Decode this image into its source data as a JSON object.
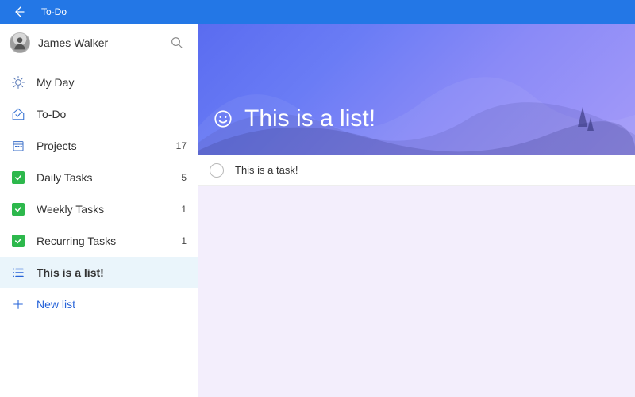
{
  "titlebar": {
    "app_name": "To-Do"
  },
  "profile": {
    "username": "James Walker"
  },
  "sidebar": {
    "items": [
      {
        "label": "My Day",
        "count": "",
        "icon": "sun"
      },
      {
        "label": "To-Do",
        "count": "",
        "icon": "home-check"
      },
      {
        "label": "Projects",
        "count": "17",
        "icon": "calendar"
      },
      {
        "label": "Daily Tasks",
        "count": "5",
        "icon": "green-check"
      },
      {
        "label": "Weekly Tasks",
        "count": "1",
        "icon": "green-check"
      },
      {
        "label": "Recurring Tasks",
        "count": "1",
        "icon": "green-check"
      },
      {
        "label": "This is a list!",
        "count": "",
        "icon": "list"
      }
    ],
    "new_list_label": "New list"
  },
  "list_view": {
    "title": "This is a list!",
    "tasks": [
      {
        "title": "This is a task!"
      }
    ]
  }
}
